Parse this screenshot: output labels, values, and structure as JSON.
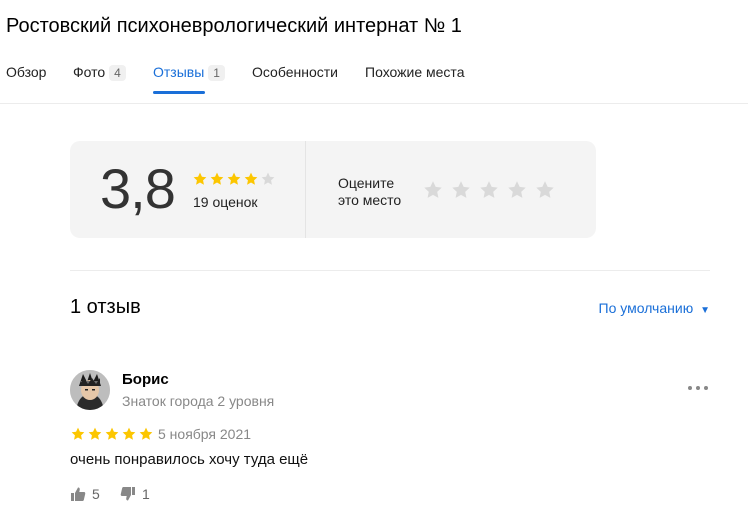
{
  "page": {
    "title": "Ростовский психоневрологический интернат № 1"
  },
  "tabs": [
    {
      "label": "Обзор",
      "count": null,
      "active": false
    },
    {
      "label": "Фото",
      "count": "4",
      "active": false
    },
    {
      "label": "Отзывы",
      "count": "1",
      "active": true
    },
    {
      "label": "Особенности",
      "count": null,
      "active": false
    },
    {
      "label": "Похожие места",
      "count": null,
      "active": false
    }
  ],
  "rating": {
    "value": "3,8",
    "stars_filled": 4,
    "stars_total": 5,
    "count_text": "19 оценок",
    "rate_prompt_line1": "Оцените",
    "rate_prompt_line2": "это место"
  },
  "reviews_header": {
    "count_label": "1 отзыв",
    "sort_label": "По умолчанию"
  },
  "review": {
    "author": "Борис",
    "level": "Знаток города 2 уровня",
    "stars_filled": 5,
    "date": "5 ноября 2021",
    "text": "очень понравилось хочу туда ещё",
    "likes": "5",
    "dislikes": "1"
  },
  "colors": {
    "accent": "#1a6fd8",
    "star_filled": "#fcc600",
    "star_empty": "#d9d9d9",
    "card_bg": "#f4f4f4"
  }
}
